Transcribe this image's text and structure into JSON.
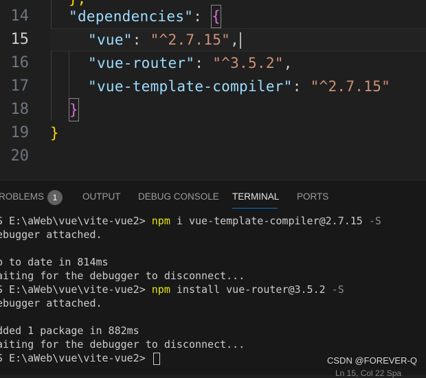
{
  "editor": {
    "top_stub": "},",
    "lines": [
      {
        "number": "14",
        "indent": "  ",
        "key": "\"dependencies\"",
        "colon": ": ",
        "brace": "{"
      },
      {
        "number": "15",
        "key": "\"vue\"",
        "colon": ": ",
        "value": "\"^2.7.15\"",
        "comma": ","
      },
      {
        "number": "16",
        "key": "\"vue-router\"",
        "colon": ": ",
        "value": "\"^3.5.2\"",
        "comma": ","
      },
      {
        "number": "17",
        "key": "\"vue-template-compiler\"",
        "colon": ": ",
        "value": "\"^2.7.15\""
      },
      {
        "number": "18",
        "brace": "}"
      },
      {
        "number": "19",
        "brace": "}"
      },
      {
        "number": "20"
      }
    ]
  },
  "panel": {
    "tabs": {
      "problems": "ROBLEMS",
      "problems_count": "1",
      "output": "OUTPUT",
      "debug_console": "DEBUG CONSOLE",
      "terminal": "TERMINAL",
      "ports": "PORTS"
    },
    "terminal": {
      "l1_prompt": "S E:\\aWeb\\vue\\vite-vue2> ",
      "l1_npm": "npm",
      "l1_cmd": " i vue-template-compiler@2.7.15 ",
      "l1_flag": "-S",
      "l2": "ebugger attached.",
      "l3": "",
      "l4": "p to date in 814ms",
      "l5": "aiting for the debugger to disconnect...",
      "l6_prompt": "S E:\\aWeb\\vue\\vite-vue2> ",
      "l6_npm": "npm",
      "l6_cmd": " install vue-router@3.5.2 ",
      "l6_flag": "-S",
      "l7": "ebugger attached.",
      "l8": "",
      "l9": "dded 1 package in 882ms",
      "l10": "aiting for the debugger to disconnect...",
      "l11_prompt": "S E:\\aWeb\\vue\\vite-vue2> "
    }
  },
  "watermark": "CSDN @FOREVER-Q",
  "statusbar": "Ln 15, Col 22   Spa"
}
